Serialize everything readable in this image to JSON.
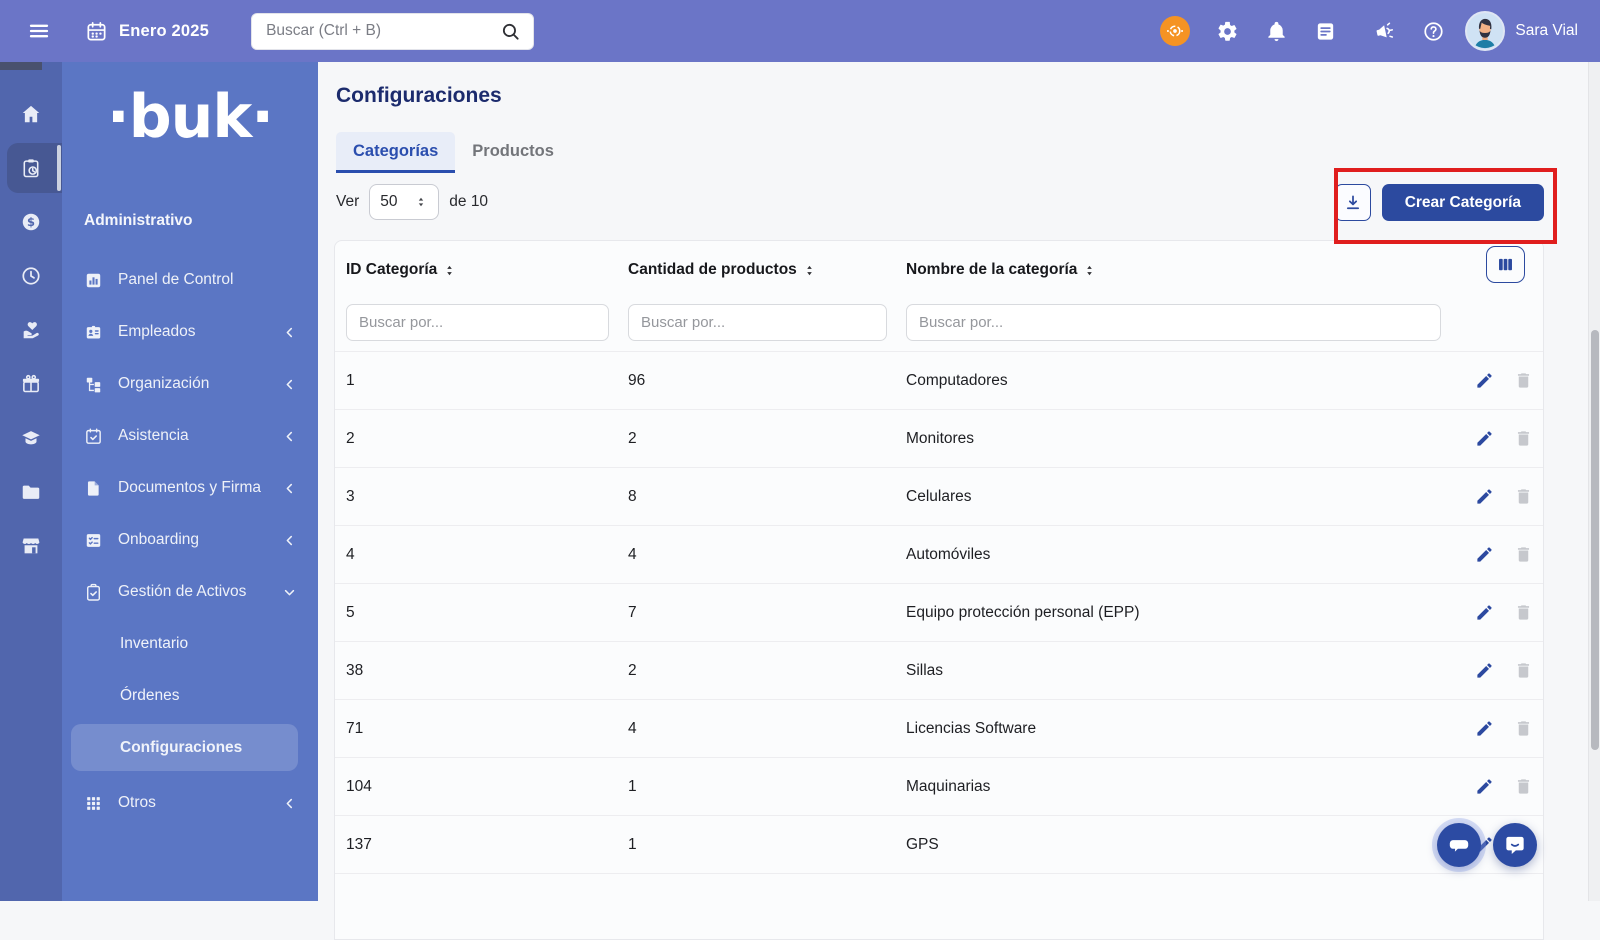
{
  "colors": {
    "topbar": "#6B75C7",
    "rail": "#5166AD",
    "sidebar": "#5B76C4",
    "accent_blue": "#2C4A9F",
    "title_navy": "#1C2B6D",
    "highlight_red": "#E01E1E",
    "notification_orange": "#F59323"
  },
  "topbar": {
    "date": "Enero 2025",
    "search_placeholder": "Buscar (Ctrl + B)",
    "user_name": "Sara Vial"
  },
  "rail": {
    "items": [
      {
        "name": "home",
        "icon": "home-icon",
        "active": false
      },
      {
        "name": "asset-management",
        "icon": "clipboard-clock-icon",
        "active": true
      },
      {
        "name": "remuneration",
        "icon": "dollar-icon",
        "active": false
      },
      {
        "name": "time",
        "icon": "clock-icon",
        "active": false
      },
      {
        "name": "benefits",
        "icon": "hand-heart-icon",
        "active": false
      },
      {
        "name": "celebrations",
        "icon": "gift-icon",
        "active": false
      },
      {
        "name": "training",
        "icon": "graduation-cap-icon",
        "active": false
      },
      {
        "name": "files",
        "icon": "folder-icon",
        "active": false
      },
      {
        "name": "marketplace",
        "icon": "store-icon",
        "active": false
      }
    ]
  },
  "sidebar": {
    "logo": "·buk·",
    "section": "Administrativo",
    "items": [
      {
        "label": "Panel de Control",
        "icon": "bar-chart-icon"
      },
      {
        "label": "Empleados",
        "icon": "id-badge-icon",
        "chevron": "left"
      },
      {
        "label": "Organización",
        "icon": "org-chart-icon",
        "chevron": "left"
      },
      {
        "label": "Asistencia",
        "icon": "calendar-check-icon",
        "chevron": "left"
      },
      {
        "label": "Documentos y Firma",
        "icon": "document-icon",
        "chevron": "left"
      },
      {
        "label": "Onboarding",
        "icon": "task-list-icon",
        "chevron": "left"
      },
      {
        "label": "Gestión de Activos",
        "icon": "clipboard-check-icon",
        "chevron": "down"
      },
      {
        "label": "Inventario",
        "sub": true
      },
      {
        "label": "Órdenes",
        "sub": true
      },
      {
        "label": "Configuraciones",
        "sub": true,
        "active": true
      },
      {
        "label": "Otros",
        "icon": "grid-icon",
        "chevron": "left",
        "last": true
      }
    ]
  },
  "main": {
    "title": "Configuraciones",
    "tabs": [
      {
        "label": "Categorías",
        "active": true
      },
      {
        "label": "Productos",
        "active": false
      }
    ],
    "view": {
      "label": "Ver",
      "page_size": "50",
      "total": "de 10"
    },
    "toolbar": {
      "create_label": "Crear Categoría"
    },
    "table": {
      "columns": [
        {
          "label": "ID Categoría"
        },
        {
          "label": "Cantidad de productos"
        },
        {
          "label": "Nombre de la categoría"
        }
      ],
      "filter_placeholder": "Buscar por...",
      "rows": [
        {
          "id": "1",
          "count": "96",
          "name": "Computadores"
        },
        {
          "id": "2",
          "count": "2",
          "name": "Monitores"
        },
        {
          "id": "3",
          "count": "8",
          "name": "Celulares"
        },
        {
          "id": "4",
          "count": "4",
          "name": "Automóviles"
        },
        {
          "id": "5",
          "count": "7",
          "name": "Equipo protección personal (EPP)"
        },
        {
          "id": "38",
          "count": "2",
          "name": "Sillas"
        },
        {
          "id": "71",
          "count": "4",
          "name": "Licencias Software"
        },
        {
          "id": "104",
          "count": "1",
          "name": "Maquinarias"
        },
        {
          "id": "137",
          "count": "1",
          "name": "GPS"
        }
      ]
    }
  }
}
